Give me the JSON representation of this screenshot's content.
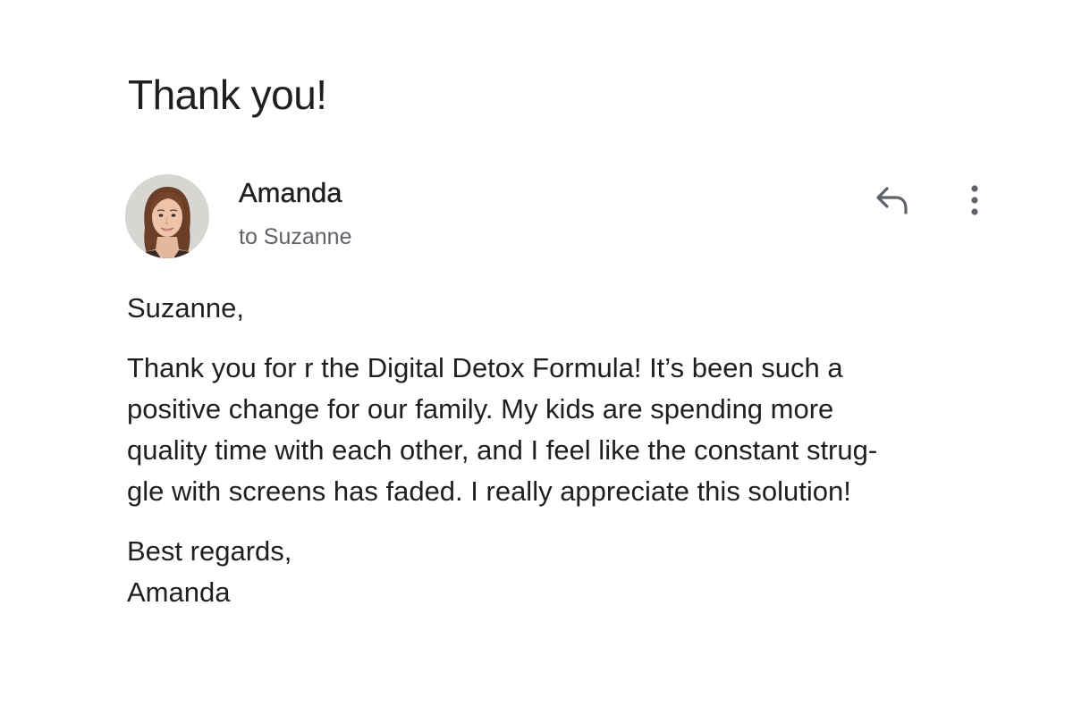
{
  "email": {
    "subject": "Thank you!",
    "sender": {
      "name": "Amanda",
      "avatar_icon": "profile-photo"
    },
    "recipient_line": "to Suzanne",
    "actions": {
      "reply_icon": "reply-arrow-icon",
      "more_icon": "vertical-ellipsis-icon"
    },
    "body": {
      "greeting": "Suzanne,",
      "paragraph_lines": [
        "Thank you for r the Digital Detox Formula! It’s been such a",
        "positive change for our family. My kids are spending more",
        "quality time with each other, and I feel like the constant strug-",
        "gle with screens has faded. I really appreciate this solution!"
      ],
      "closing": "Best regards,",
      "signature": "Amanda"
    }
  },
  "colors": {
    "text_primary": "#1f1f1f",
    "text_secondary": "#5f6368",
    "icon": "#5f6368"
  }
}
